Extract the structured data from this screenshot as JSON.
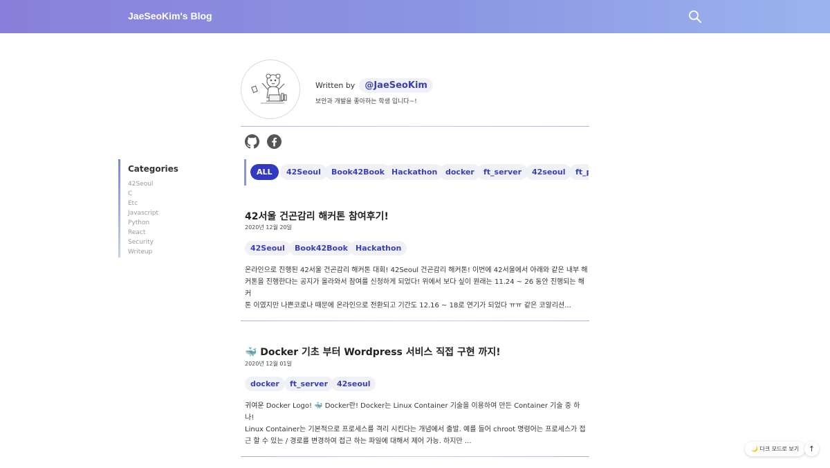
{
  "header": {
    "title": "JaeSeoKim's Blog",
    "search_icon": "search-icon"
  },
  "bio": {
    "written_by": "Written by",
    "author": "@JaeSeoKim",
    "description": "보안과 개발을 좋아하는 학생 입니다~!",
    "social": [
      "github-icon",
      "facebook-icon"
    ]
  },
  "categories": {
    "title": "Categories",
    "items": [
      "42Seoul",
      "C",
      "Etc",
      "Javascript",
      "Python",
      "React",
      "Security",
      "Writeup"
    ]
  },
  "tag_filter": {
    "tags": [
      "ALL",
      "42Seoul",
      "Book42Book",
      "Hackathon",
      "docker",
      "ft_server",
      "42seoul",
      "ft_p"
    ],
    "active": "ALL"
  },
  "posts": [
    {
      "title": "42서울 건곤감리 해커톤 참여후기!",
      "date": "2020년 12월 20일",
      "tags": [
        "42Seoul",
        "Book42Book",
        "Hackathon"
      ],
      "excerpt": [
        "온라인으로 진행된 42서울 건곤감리 해커톤 대회! 42Seoul 건곤감리 해커톤! 이번에 42서울에서 아래와 같은 내부 해",
        "커톤을 진행한다는 공지가 올라와서 참여를 신청하게 되었다! 위에서 보다 싶이 원래는 11.24 ~ 26 동안 진행되는 해커",
        "톤 이였지만 나쁜코로나 때문에 온라인으로 전환되고 기간도 12.16 ~ 18로 연기가 되었다 ㅠㅠ 같은 코알리션..."
      ]
    },
    {
      "title": "🐳 Docker 기초 부터 Wordpress 서비스 직접 구현 까지!",
      "date": "2020년 12월 01일",
      "tags": [
        "docker",
        "ft_server",
        "42seoul"
      ],
      "excerpt": [
        "귀여운 Docker Logo! 🐳 Docker란! Docker는 Linux Container 기술을 이용하여 만든 Container 기술 중 하나!",
        "Linux Container는 기본적으로 프로세스를 격리 시킨다는 개념에서 출발. 예를 들어 chroot 명령어는 프로세스가 접",
        "근 할 수 있는 / 경로를 변경하여 접근 하는 파일에 대해서 제어 가능. 하지만 ..."
      ]
    }
  ],
  "floating": {
    "dark_mode_label": "다크 모드로 보기",
    "dark_mode_icon": "moon-icon",
    "top_icon": "arrow-up-icon"
  }
}
